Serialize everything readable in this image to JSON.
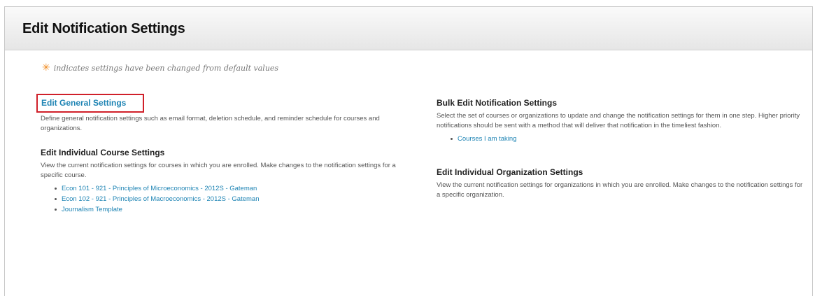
{
  "header": {
    "title": "Edit Notification Settings"
  },
  "legend": {
    "icon": "asterisk-icon",
    "icon_color": "#f08a1f",
    "text": "indicates settings have been changed from default values"
  },
  "general": {
    "link_label": "Edit General Settings",
    "description": "Define general notification settings such as email format, deletion schedule, and reminder schedule for courses and organizations.",
    "highlight_color": "#d0202a"
  },
  "course_settings": {
    "heading": "Edit Individual Course Settings",
    "description": "View the current notification settings for courses in which you are enrolled. Make changes to the notification settings for a specific course.",
    "courses": [
      "Econ 101 - 921 - Principles of Microeconomics - 2012S - Gateman",
      "Econ 102 - 921 - Principles of Macroeconomics - 2012S - Gateman",
      "Journalism Template"
    ]
  },
  "bulk": {
    "heading": "Bulk Edit Notification Settings",
    "description": "Select the set of courses or organizations to update and change the notification settings for them in one step. Higher priority notifications should be sent with a method that will deliver that notification in the timeliest fashion.",
    "links": [
      "Courses I am taking"
    ]
  },
  "organization_settings": {
    "heading": "Edit Individual Organization Settings",
    "description": "View the current notification settings for organizations in which you are enrolled. Make changes to the notification settings for a specific organization."
  },
  "colors": {
    "link": "#1e84b4",
    "heading": "#222222"
  }
}
